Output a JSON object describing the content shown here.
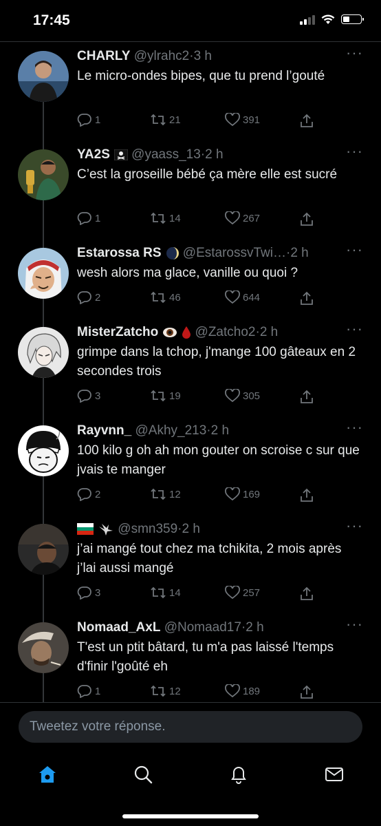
{
  "status_bar": {
    "time": "17:45"
  },
  "tweets": [
    {
      "name": "CHARLY",
      "handle": "@ylrahc2",
      "time": "3 h",
      "text": "Le micro-ondes bipes, que tu prend l’gouté",
      "replies": "1",
      "retweets": "21",
      "likes": "391"
    },
    {
      "name": "YA2S",
      "handle": "@yaass_13",
      "time": "2 h",
      "text": "C’est la groseille bébé ça mère elle est sucré",
      "replies": "1",
      "retweets": "14",
      "likes": "267"
    },
    {
      "name": "Estarossa RS",
      "handle": "@EstarossvTwi…",
      "time": "2 h",
      "text": "wesh alors ma glace, vanille ou quoi ?",
      "replies": "2",
      "retweets": "46",
      "likes": "644"
    },
    {
      "name": "MisterZatcho",
      "handle": "@Zatcho2",
      "time": "2 h",
      "text": "grimpe dans la tchop, j'mange 100 gâteaux en 2 secondes trois",
      "replies": "3",
      "retweets": "19",
      "likes": "305"
    },
    {
      "name": "Rayvnn_",
      "handle": "@Akhy_213",
      "time": "2 h",
      "text": "100 kilo g oh ah mon gouter on scroise c sur que jvais te manger",
      "replies": "2",
      "retweets": "12",
      "likes": "169"
    },
    {
      "name": "",
      "handle": "@smn359",
      "time": "2 h",
      "text": "j’ai mangé tout chez ma tchikita, 2 mois après j’lai aussi mangé",
      "replies": "3",
      "retweets": "14",
      "likes": "257"
    },
    {
      "name": "Nomaad_AxL",
      "handle": "@Nomaad17",
      "time": "2 h",
      "text": "T'est un ptit bâtard, tu m'a pas laissé l'temps d'finir l'goûté eh",
      "replies": "1",
      "retweets": "12",
      "likes": "189"
    }
  ],
  "separator": "·",
  "more_label": "···",
  "reply_box": {
    "placeholder": "Tweetez votre réponse."
  },
  "tabs": [
    "home-icon",
    "search-icon",
    "notifications-icon",
    "messages-icon"
  ],
  "colors": {
    "background": "#000000",
    "accent": "#1d9bf0",
    "muted": "#71767b"
  }
}
